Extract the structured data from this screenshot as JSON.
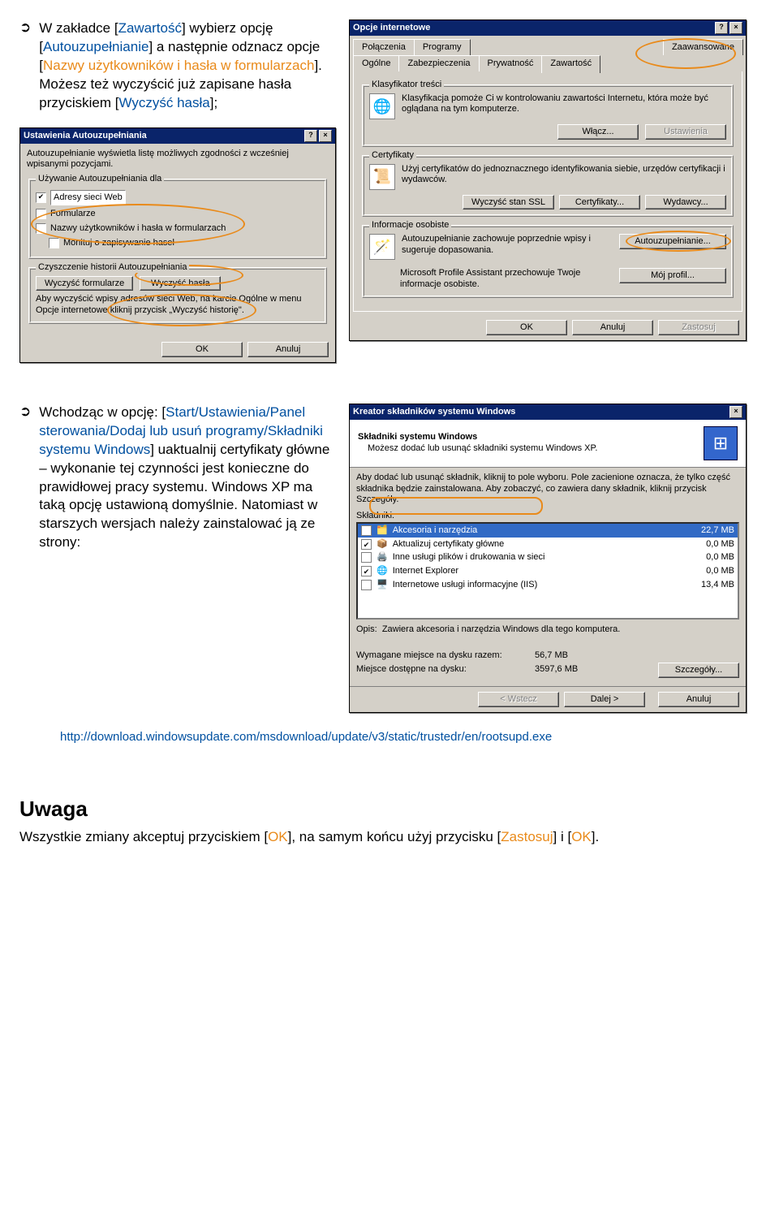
{
  "bullets": {
    "b1_a": "W zakładce [",
    "b1_b": "Zawartość",
    "b1_c": "] wybierz opcję [",
    "b1_d": "Autouzupełnianie",
    "b1_e": "] a następnie odznacz opcje [",
    "b1_f": "Nazwy użytkowników i hasła w formularzach",
    "b1_g": "]. Możesz też wyczyścić już zapisane hasła przyciskiem [",
    "b1_h": "Wyczyść hasła",
    "b1_i": "];",
    "b2_a": "Wchodząc w opcję: [",
    "b2_b": "Start/Ustawienia/Panel sterowania/Dodaj lub usuń programy/Składniki systemu Windows",
    "b2_c": "] uaktualnij certyfikaty główne – wykonanie tej czynności jest konieczne do prawidłowej pracy systemu. Windows XP ma taką opcję ustawioną domyślnie. Natomiast w starszych wersjach należy zainstalować ją ze strony:"
  },
  "dlg1": {
    "title": "Ustawienia Autouzupełniania",
    "intro": "Autouzupełnianie wyświetla listę możliwych zgodności z wcześniej wpisanymi pozycjami.",
    "g1": "Używanie Autouzupełniania dla",
    "c1": "Adresy sieci Web",
    "c2": "Formularze",
    "c3": "Nazwy użytkowników i hasła w formularzach",
    "c4": "Monituj o zapisywanie haseł",
    "g2": "Czyszczenie historii Autouzupełniania",
    "btn_cf": "Wyczyść formularze",
    "btn_ch": "Wyczyść hasła",
    "note": "Aby wyczyścić wpisy adresów sieci Web, na karcie Ogólne w menu Opcje internetowe kliknij przycisk „Wyczyść historię\".",
    "ok": "OK",
    "cancel": "Anuluj"
  },
  "dlg2": {
    "title": "Opcje internetowe",
    "tabs_r1": [
      "Połączenia",
      "Programy",
      "Zaawansowane"
    ],
    "tabs_r2": [
      "Ogólne",
      "Zabezpieczenia",
      "Prywatność",
      "Zawartość"
    ],
    "g1": "Klasyfikator treści",
    "g1_txt": "Klasyfikacja pomoże Ci w kontrolowaniu zawartości Internetu, która może być oglądana na tym komputerze.",
    "b_wlacz": "Włącz...",
    "b_ust": "Ustawienia",
    "g2": "Certyfikaty",
    "g2_txt": "Użyj certyfikatów do jednoznacznego identyfikowania siebie, urzędów certyfikacji i wydawców.",
    "b_ssl": "Wyczyść stan SSL",
    "b_cert": "Certyfikaty...",
    "b_wyd": "Wydawcy...",
    "g3": "Informacje osobiste",
    "g3_t1": "Autouzupełnianie zachowuje poprzednie wpisy i sugeruje dopasowania.",
    "b_auto": "Autouzupełnianie...",
    "g3_t2": "Microsoft Profile Assistant przechowuje Twoje informacje osobiste.",
    "b_prof": "Mój profil...",
    "ok": "OK",
    "cancel": "Anuluj",
    "apply": "Zastosuj"
  },
  "dlg3": {
    "title": "Kreator składników systemu Windows",
    "h": "Składniki systemu Windows",
    "sub": "Możesz dodać lub usunąć składniki systemu Windows XP.",
    "instr": "Aby dodać lub usunąć składnik, kliknij to pole wyboru. Pole zacienione oznacza, że tylko część składnika będzie zainstalowana. Aby zobaczyć, co zawiera dany składnik, kliknij przycisk Szczegóły.",
    "lbl_list": "Składniki:",
    "items": [
      {
        "chk": "✔",
        "name": "Akcesoria i narzędzia",
        "size": "22,7 MB",
        "sel": true
      },
      {
        "chk": "✔",
        "name": "Aktualizuj certyfikaty główne",
        "size": "0,0 MB"
      },
      {
        "chk": "",
        "name": "Inne usługi plików i drukowania w sieci",
        "size": "0,0 MB"
      },
      {
        "chk": "✔",
        "name": "Internet Explorer",
        "size": "0,0 MB"
      },
      {
        "chk": "",
        "name": "Internetowe usługi informacyjne (IIS)",
        "size": "13,4 MB"
      }
    ],
    "opis_l": "Opis:",
    "opis": "Zawiera akcesoria i narzędzia Windows dla tego komputera.",
    "req_l": "Wymagane miejsce na dysku razem:",
    "req": "56,7 MB",
    "free_l": "Miejsce dostępne na dysku:",
    "free": "3597,6 MB",
    "b_det": "Szczegóły...",
    "b_back": "< Wstecz",
    "b_next": "Dalej >",
    "b_cancel": "Anuluj"
  },
  "url": "http://download.windowsupdate.com/msdownload/update/v3/static/trustedr/en/rootsupd.exe",
  "uwaga": {
    "h": "Uwaga",
    "t1": "Wszystkie zmiany akceptuj przyciskiem [",
    "ok": "OK",
    "t2": "], na samym końcu użyj przycisku [",
    "z": "Zastosuj",
    "t3": "] i [",
    "ok2": "OK",
    "t4": "]."
  }
}
